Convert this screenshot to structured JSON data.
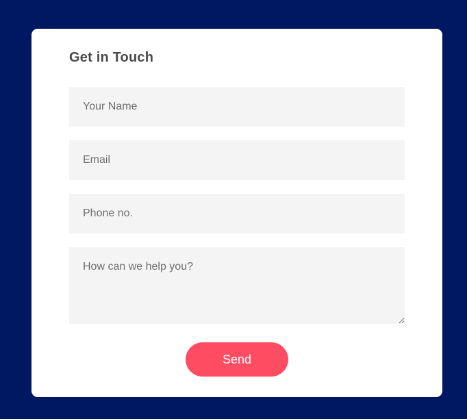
{
  "form": {
    "title": "Get in Touch",
    "fields": {
      "name": {
        "placeholder": "Your Name",
        "value": ""
      },
      "email": {
        "placeholder": "Email",
        "value": ""
      },
      "phone": {
        "placeholder": "Phone no.",
        "value": ""
      },
      "message": {
        "placeholder": "How can we help you?",
        "value": ""
      }
    },
    "submit_label": "Send"
  },
  "colors": {
    "background": "#001861",
    "card": "#ffffff",
    "field_background": "#f4f4f4",
    "title_text": "#4a4a4a",
    "button": "#fe4c63",
    "button_text": "#ffffff"
  }
}
